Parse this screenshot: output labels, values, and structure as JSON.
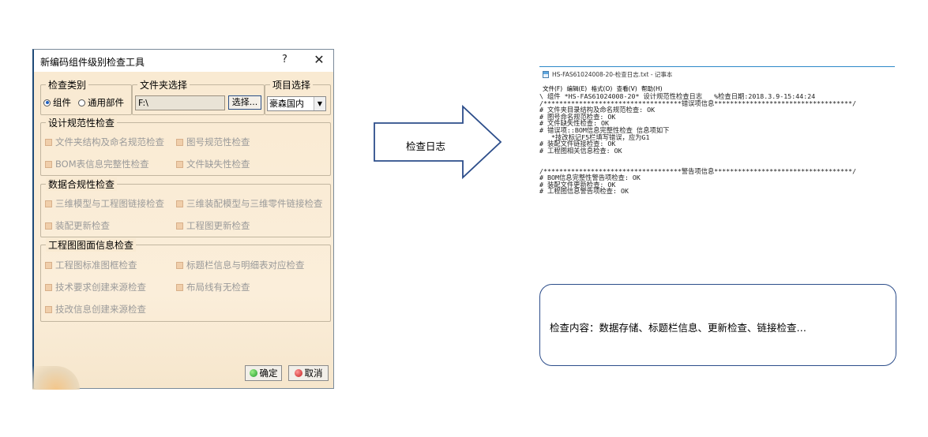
{
  "dialog": {
    "title": "新编码组件级别检查工具",
    "help_label": "?",
    "close_label": "✕",
    "check_type": {
      "label": "检查类别",
      "options": [
        {
          "label": "组件",
          "selected": true
        },
        {
          "label": "通用部件",
          "selected": false
        }
      ]
    },
    "folder": {
      "label": "文件夹选择",
      "value": "F:\\",
      "browse_label": "选择..."
    },
    "project": {
      "label": "项目选择",
      "value": "豪森国内"
    },
    "group_design": {
      "title": "设计规范性检查",
      "items": [
        "文件夹结构及命名规范检查",
        "图号规范性检查",
        "BOM表信息完整性检查",
        "文件缺失性检查"
      ]
    },
    "group_data": {
      "title": "数据合规性检查",
      "items": [
        "三维模型与工程图链接检查",
        "三维装配模型与三维零件链接检查",
        "装配更新检查",
        "工程图更新检查"
      ]
    },
    "group_drawing": {
      "title": "工程图图面信息检查",
      "items": [
        "工程图标准图框检查",
        "标题栏信息与明细表对应检查",
        "技术要求创建来源检查",
        "布局线有无检查",
        "技改信息创建来源检查"
      ]
    },
    "ok_label": "确定",
    "cancel_label": "取消"
  },
  "arrow": {
    "label": "检查日志"
  },
  "notepad": {
    "title": "HS-FAS61024008-20-检查日志.txt - 记事本",
    "menu": "文件(F) 编辑(E) 格式(O) 查看(V) 帮助(H)",
    "lines": [
      "\\ 组件 *HS-FAS61024008-20* 设计规范性检查日志   %检查日期:2018.3.9-15:44:24",
      "/***********************************错误项信息***********************************/",
      "# 文件夹目录结构及命名规范检查: OK",
      "# 图号命名规范检查: OK",
      "# 文件缺失性检查: OK",
      "# 错误项::BOM信息完整性检查 信息项如下",
      "   *技改标记F5栏填写错误，应为G1",
      "# 装配文件链接检查: OK",
      "# 工程图相关信息检查: OK",
      "",
      "",
      "/***********************************警告项信息***********************************/",
      "# BOM信息完整性警告项检查: OK",
      "# 装配文件更新检查: OK",
      "# 工程图信息警告项检查: OK"
    ]
  },
  "callout": {
    "text": "检查内容：数据存储、标题栏信息、更新检查、链接检查…"
  }
}
